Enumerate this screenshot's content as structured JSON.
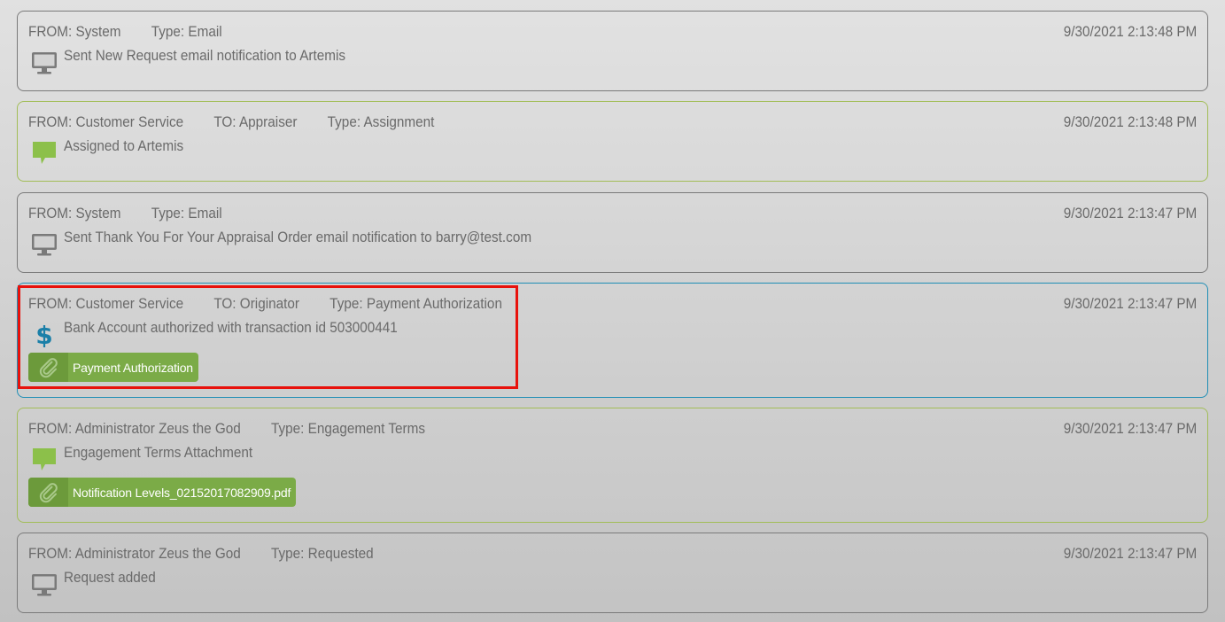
{
  "colors": {
    "border_gray": "#7a7a7a",
    "border_green": "#a2bd57",
    "border_blue": "#1f8eb5",
    "text": "#6a6a6a",
    "attachment_bg": "#7bab47",
    "attachment_icon_bg": "#6c9a3b",
    "highlight": "#e8120c",
    "monitor_icon": "#7a7a7a",
    "chat_icon": "#8cc04a",
    "dollar_icon": "#1a7fa8"
  },
  "feed": {
    "entries": [
      {
        "from": "FROM: System",
        "to": "",
        "type": "Type: Email",
        "timestamp": "9/30/2021 2:13:48 PM",
        "icon": "monitor-icon",
        "message": "Sent New Request email notification to Artemis",
        "attachment": ""
      },
      {
        "from": "FROM: Customer Service",
        "to": "TO: Appraiser",
        "type": "Type: Assignment",
        "timestamp": "9/30/2021 2:13:48 PM",
        "icon": "chat-bubble-icon",
        "message": "Assigned to Artemis",
        "attachment": ""
      },
      {
        "from": "FROM: System",
        "to": "",
        "type": "Type: Email",
        "timestamp": "9/30/2021 2:13:47 PM",
        "icon": "monitor-icon",
        "message": "Sent Thank You For Your Appraisal Order email notification to barry@test.com",
        "attachment": ""
      },
      {
        "from": "FROM: Customer Service",
        "to": "TO: Originator",
        "type": "Type: Payment Authorization",
        "timestamp": "9/30/2021 2:13:47 PM",
        "icon": "dollar-icon",
        "message": "Bank Account authorized with transaction id 503000441",
        "attachment": "Payment Authorization"
      },
      {
        "from": "FROM: Administrator Zeus the God",
        "to": "",
        "type": "Type: Engagement Terms",
        "timestamp": "9/30/2021 2:13:47 PM",
        "icon": "chat-bubble-icon",
        "message": "Engagement Terms Attachment",
        "attachment": "Notification Levels_02152017082909.pdf"
      },
      {
        "from": "FROM: Administrator Zeus the God",
        "to": "",
        "type": "Type: Requested",
        "timestamp": "9/30/2021 2:13:47 PM",
        "icon": "monitor-icon",
        "message": "Request added",
        "attachment": ""
      }
    ]
  }
}
